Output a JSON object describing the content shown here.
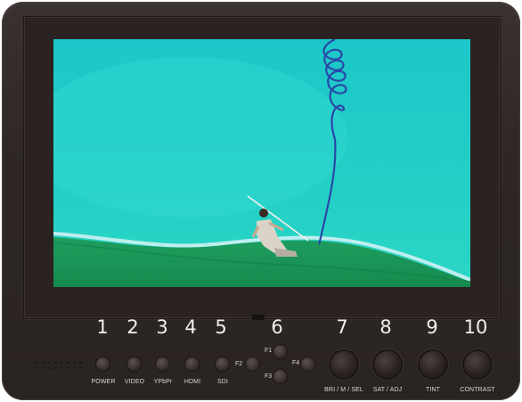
{
  "numbers": [
    "1",
    "2",
    "3",
    "4",
    "5",
    "6",
    "7",
    "8",
    "9",
    "10"
  ],
  "buttons": {
    "power": "POWER",
    "video": "VIDEO",
    "ypbpr": "YPbPr",
    "hdmi": "HDMI",
    "sdi": "SDI",
    "f1": "F1",
    "f2": "F2",
    "f3": "F3",
    "f4": "F4"
  },
  "knobs": {
    "bri": "BRI / M / SEL",
    "sat": "SAT / ADJ",
    "tint": "TINT",
    "contrast": "CONTRAST"
  },
  "colors": {
    "body": "#2e2725",
    "screen_water": "#21c8c6",
    "ground": "#1f9c5a",
    "rope": "#2a47a8"
  }
}
